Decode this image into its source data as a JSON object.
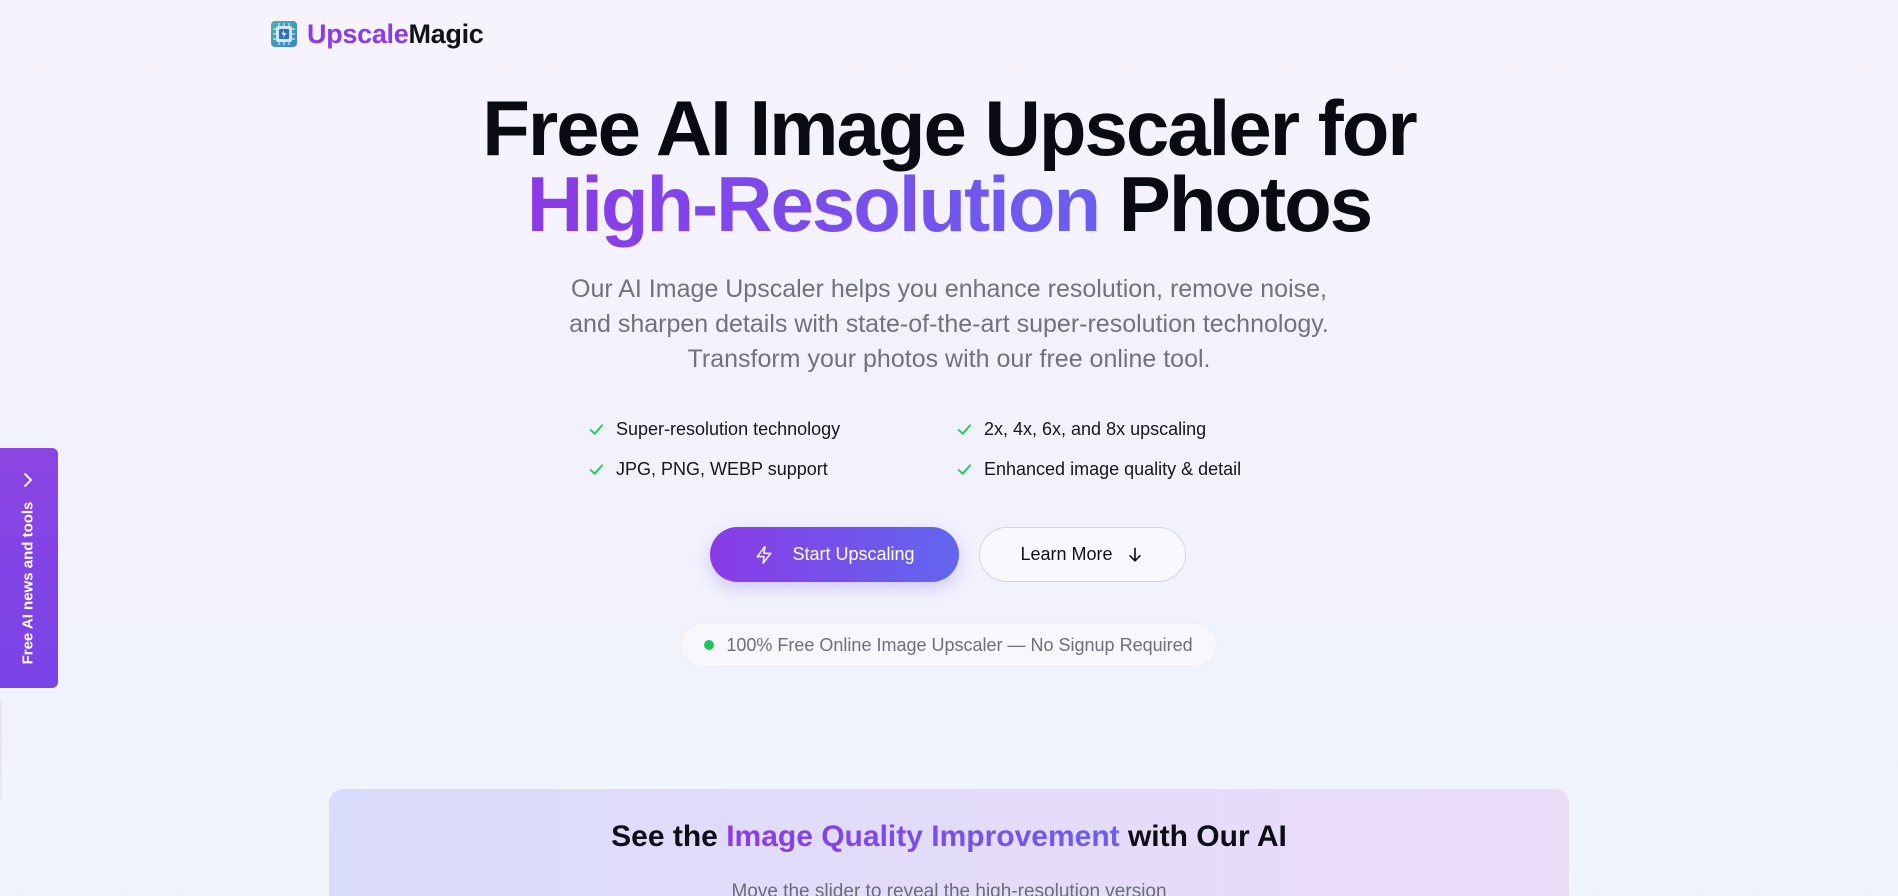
{
  "brand": {
    "name_part1": "Upscale",
    "name_part2": "Magic",
    "logo_icon": "circuit-chip-icon",
    "accent_color": "#8a3de6"
  },
  "hero": {
    "title_line1": "Free AI Image Upscaler for",
    "title_highlight": "High-Resolution",
    "title_tail": "Photos",
    "subtitle_line1": "Our AI Image Upscaler helps you enhance resolution, remove noise,",
    "subtitle_line2": "and sharpen details with state-of-the-art super-resolution technology.",
    "subtitle_line3": "Transform your photos with our free online tool."
  },
  "features": [
    {
      "label": "Super-resolution technology",
      "icon": "check-icon"
    },
    {
      "label": "2x, 4x, 6x, and 8x upscaling",
      "icon": "check-icon"
    },
    {
      "label": "JPG, PNG, WEBP support",
      "icon": "check-icon"
    },
    {
      "label": "Enhanced image quality & detail",
      "icon": "check-icon"
    }
  ],
  "actions": {
    "primary_label": "Start Upscaling",
    "primary_icon": "lightning-icon",
    "secondary_label": "Learn More",
    "secondary_icon": "arrow-down-icon"
  },
  "badge": {
    "text": "100% Free Online Image Upscaler — No Signup Required",
    "dot_color": "#22c55e"
  },
  "side_tab": {
    "label": "Free AI news and tools",
    "icon": "chevron-right-icon"
  },
  "compare": {
    "title_pre": "See the ",
    "title_highlight": "Image Quality Improvement",
    "title_post": " with Our AI",
    "subtitle": "Move the slider to reveal the high-resolution version"
  }
}
